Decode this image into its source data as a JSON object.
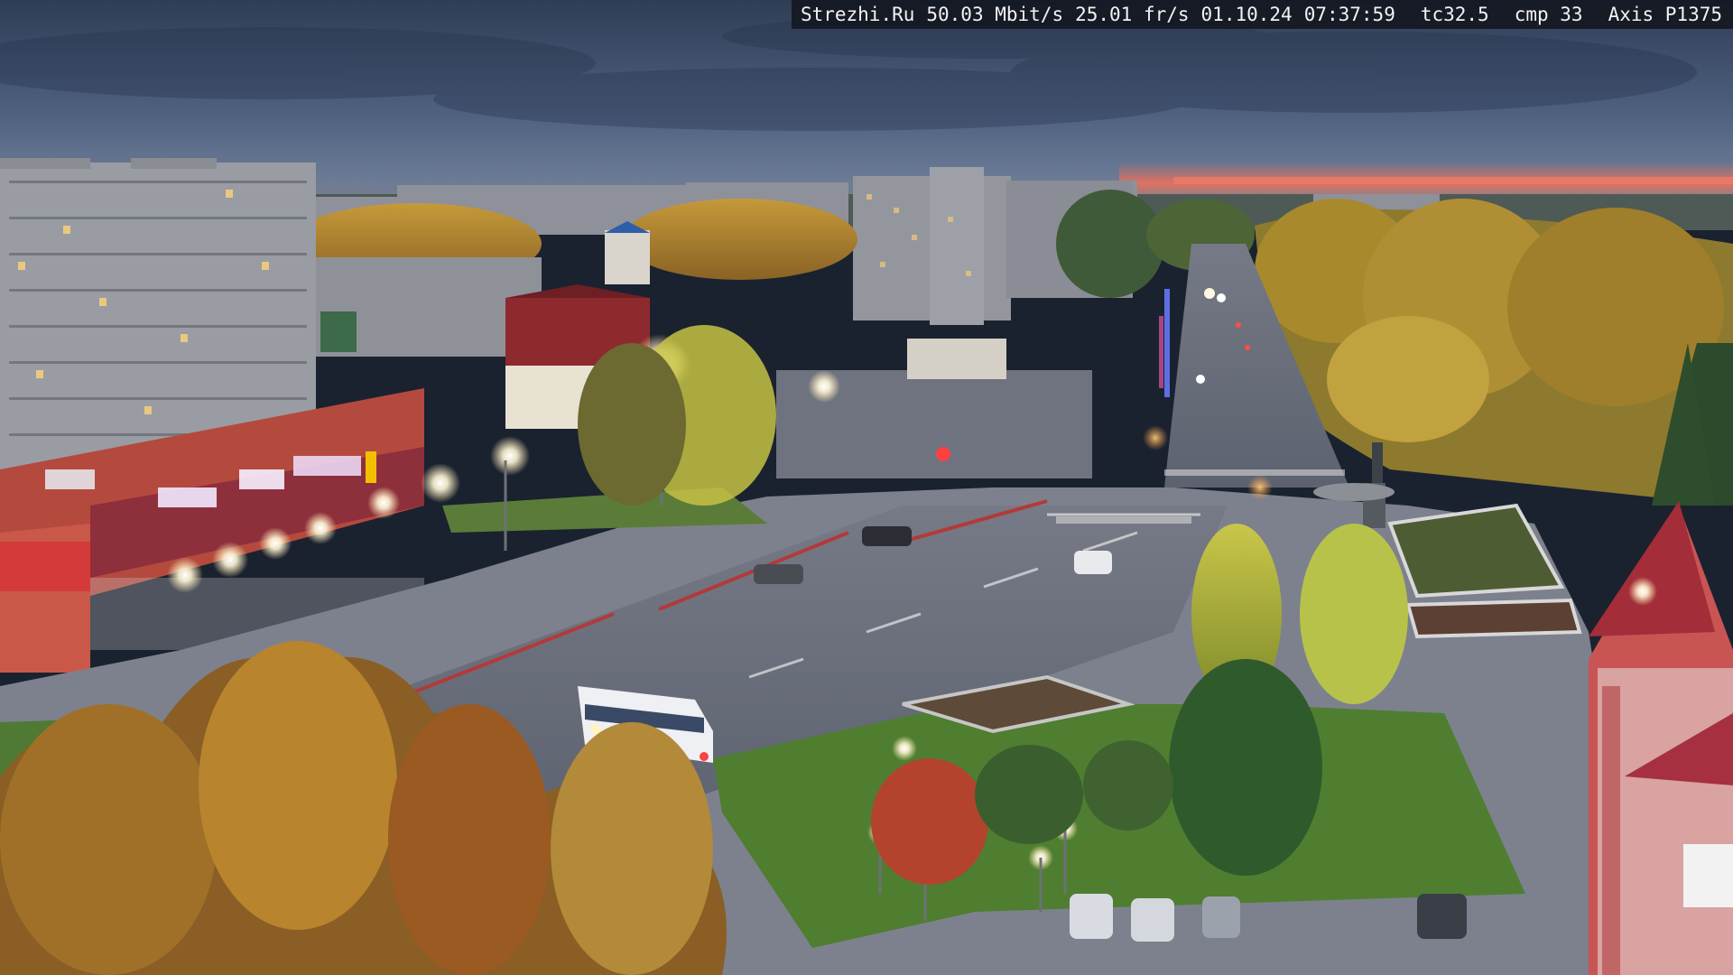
{
  "overlay": {
    "site": "Strezhi.Ru",
    "bitrate": "50.03 Mbit/s",
    "framerate": "25.01 fr/s",
    "date": "01.10.24",
    "time": "07:37:59",
    "tc": "tc32.5",
    "cmp": "cmp 33",
    "camera": "Axis P1375"
  },
  "scene": {
    "description_tags": [
      "dusk",
      "city-square",
      "boulevard",
      "autumn-trees",
      "apartment-blocks",
      "bus",
      "parked-cars"
    ],
    "colors": {
      "sky_top": "#3a4a63",
      "sky_mid": "#5a6c86",
      "horizon_glow": "#e06a58",
      "asphalt": "#6b7080",
      "grass": "#4c7a32",
      "foliage_gold": "#b88a2c",
      "building_grey": "#8c8f98",
      "brick_red": "#b4473c"
    }
  }
}
